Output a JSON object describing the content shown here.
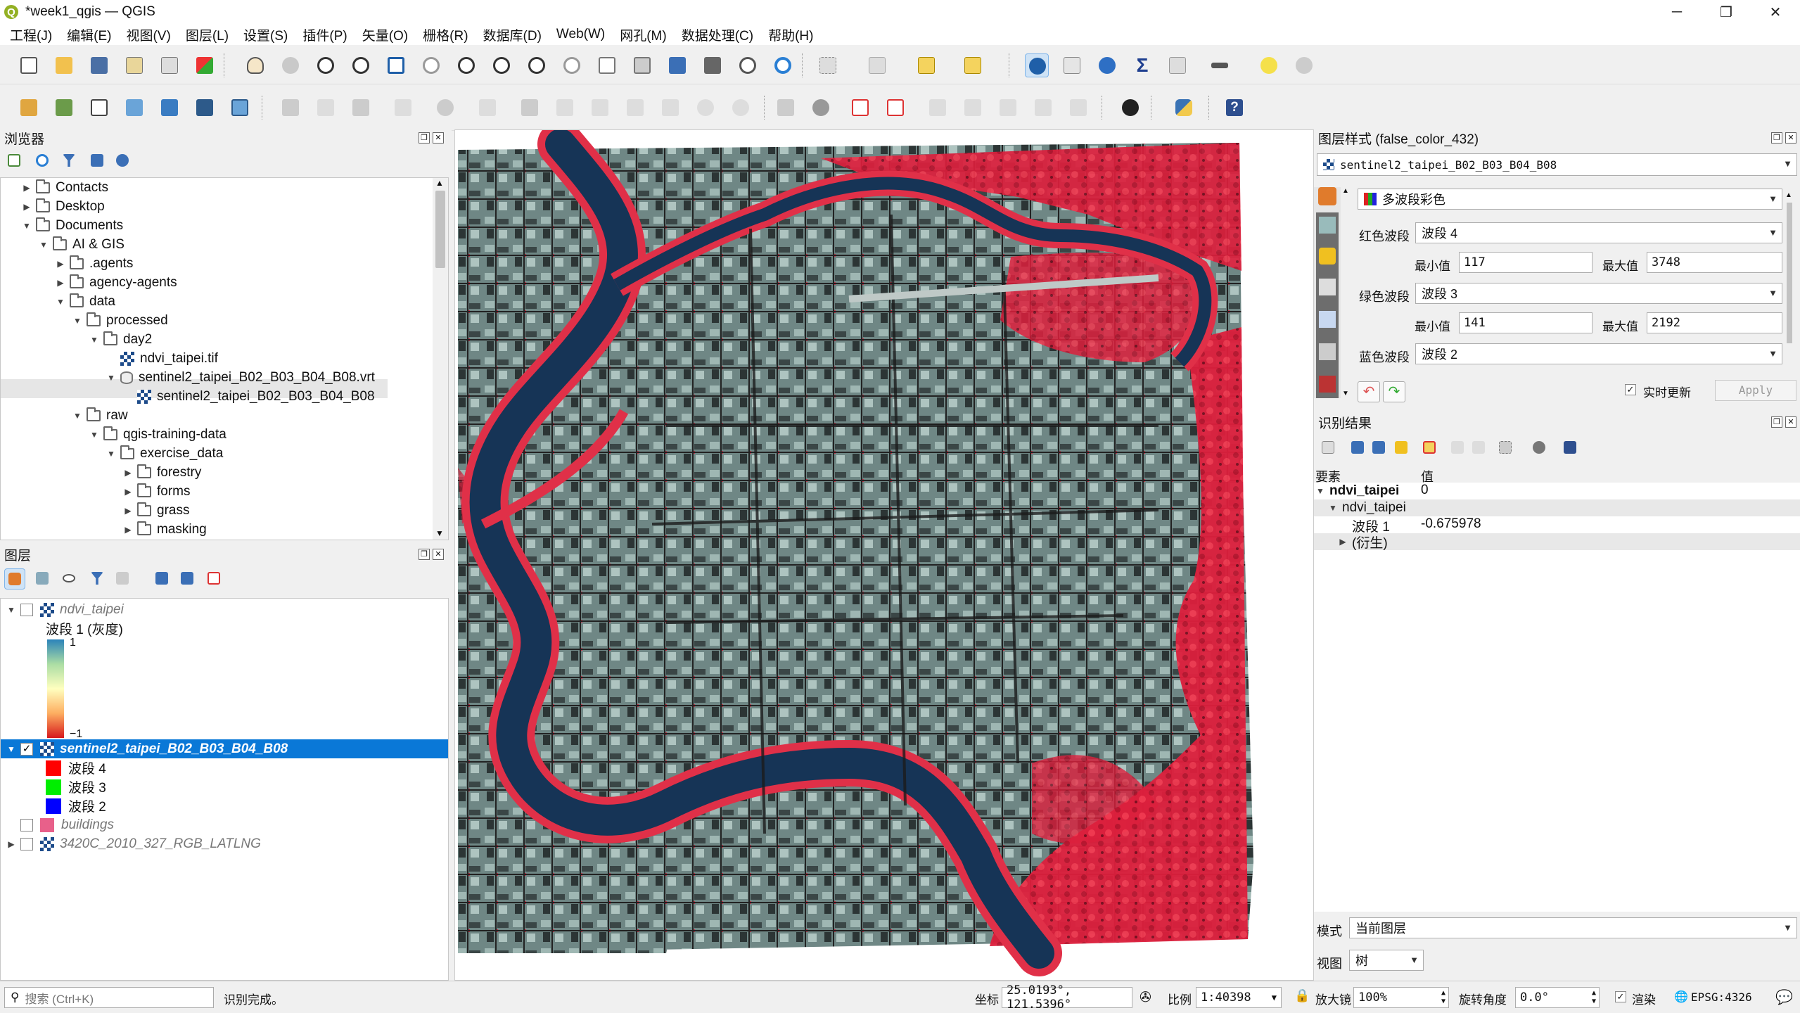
{
  "window": {
    "title": "*week1_qgis — QGIS",
    "minimize": "─",
    "maximize": "❐",
    "close": "✕"
  },
  "menu": [
    "工程(J)",
    "编辑(E)",
    "视图(V)",
    "图层(L)",
    "设置(S)",
    "插件(P)",
    "矢量(O)",
    "栅格(R)",
    "数据库(D)",
    "Web(W)",
    "网孔(M)",
    "数据处理(C)",
    "帮助(H)"
  ],
  "browser": {
    "title": "浏览器",
    "items": [
      {
        "label": "Contacts",
        "arrow": "▶",
        "kind": "folder",
        "depth": 0
      },
      {
        "label": "Desktop",
        "arrow": "▶",
        "kind": "folder",
        "depth": 0
      },
      {
        "label": "Documents",
        "arrow": "▼",
        "kind": "folder",
        "depth": 0
      },
      {
        "label": "AI & GIS",
        "arrow": "▼",
        "kind": "folder",
        "depth": 1
      },
      {
        "label": ".agents",
        "arrow": "▶",
        "kind": "folder",
        "depth": 2
      },
      {
        "label": "agency-agents",
        "arrow": "▶",
        "kind": "folder",
        "depth": 2
      },
      {
        "label": "data",
        "arrow": "▼",
        "kind": "folder",
        "depth": 2
      },
      {
        "label": "processed",
        "arrow": "▼",
        "kind": "folder",
        "depth": 3
      },
      {
        "label": "day2",
        "arrow": "▼",
        "kind": "folder",
        "depth": 4
      },
      {
        "label": "ndvi_taipei.tif",
        "arrow": "",
        "kind": "raster",
        "depth": 5
      },
      {
        "label": "sentinel2_taipei_B02_B03_B04_B08.vrt",
        "arrow": "▼",
        "kind": "vrt",
        "depth": 5
      },
      {
        "label": "sentinel2_taipei_B02_B03_B04_B08",
        "arrow": "",
        "kind": "raster",
        "depth": 6
      },
      {
        "label": "raw",
        "arrow": "▼",
        "kind": "folder",
        "depth": 3
      },
      {
        "label": "qgis-training-data",
        "arrow": "▼",
        "kind": "folder",
        "depth": 4
      },
      {
        "label": "exercise_data",
        "arrow": "▼",
        "kind": "folder",
        "depth": 5
      },
      {
        "label": "forestry",
        "arrow": "▶",
        "kind": "folder",
        "depth": 6
      },
      {
        "label": "forms",
        "arrow": "▶",
        "kind": "folder",
        "depth": 6
      },
      {
        "label": "grass",
        "arrow": "▶",
        "kind": "folder",
        "depth": 6
      },
      {
        "label": "masking",
        "arrow": "▶",
        "kind": "folder",
        "depth": 6
      }
    ]
  },
  "layers": {
    "title": "图层",
    "ndvi": {
      "name": "ndvi_taipei",
      "band": "波段 1 (灰度)",
      "max": "1",
      "min": "−1"
    },
    "sentinel": {
      "name": "sentinel2_taipei_B02_B03_B04_B08",
      "bands": [
        {
          "label": "波段 4",
          "color": "#ff0000"
        },
        {
          "label": "波段 3",
          "color": "#00ee00"
        },
        {
          "label": "波段 2",
          "color": "#0000ff"
        }
      ]
    },
    "buildings": {
      "name": "buildings",
      "color": "#e8608a"
    },
    "rgb": {
      "name": "3420C_2010_327_RGB_LATLNG"
    }
  },
  "style_panel": {
    "title": "图层样式 (false_color_432)",
    "layer_select": "sentinel2_taipei_B02_B03_B04_B08",
    "renderer": "多波段彩色",
    "red_label": "红色波段",
    "red_band": "波段 4",
    "green_label": "绿色波段",
    "green_band": "波段 3",
    "blue_label": "蓝色波段",
    "blue_band": "波段 2",
    "min_label": "最小值",
    "max_label": "最大值",
    "red_min": "117",
    "red_max": "3748",
    "green_min": "141",
    "green_max": "2192",
    "live_update": "实时更新",
    "apply": "Apply"
  },
  "identify": {
    "title": "识别结果",
    "col_feature": "要素",
    "col_value": "值",
    "layer": "ndvi_taipei",
    "layer_value": "0",
    "sub": "ndvi_taipei",
    "band_label": "波段 1",
    "band_value": "-0.675978",
    "derived": "(衍生)",
    "mode_label": "模式",
    "mode_value": "当前图层",
    "view_label": "视图",
    "view_value": "树"
  },
  "status": {
    "search_placeholder": "搜索 (Ctrl+K)",
    "message": "识别完成。",
    "coord_label": "坐标",
    "coord_value": "25.0193°, 121.5396°",
    "scale_label": "比例",
    "scale_value": "1:40398",
    "magnifier_label": "放大镜",
    "magnifier_value": "100%",
    "rotation_label": "旋转角度",
    "rotation_value": "0.0°",
    "render_label": "渲染",
    "crs": "EPSG:4326"
  }
}
